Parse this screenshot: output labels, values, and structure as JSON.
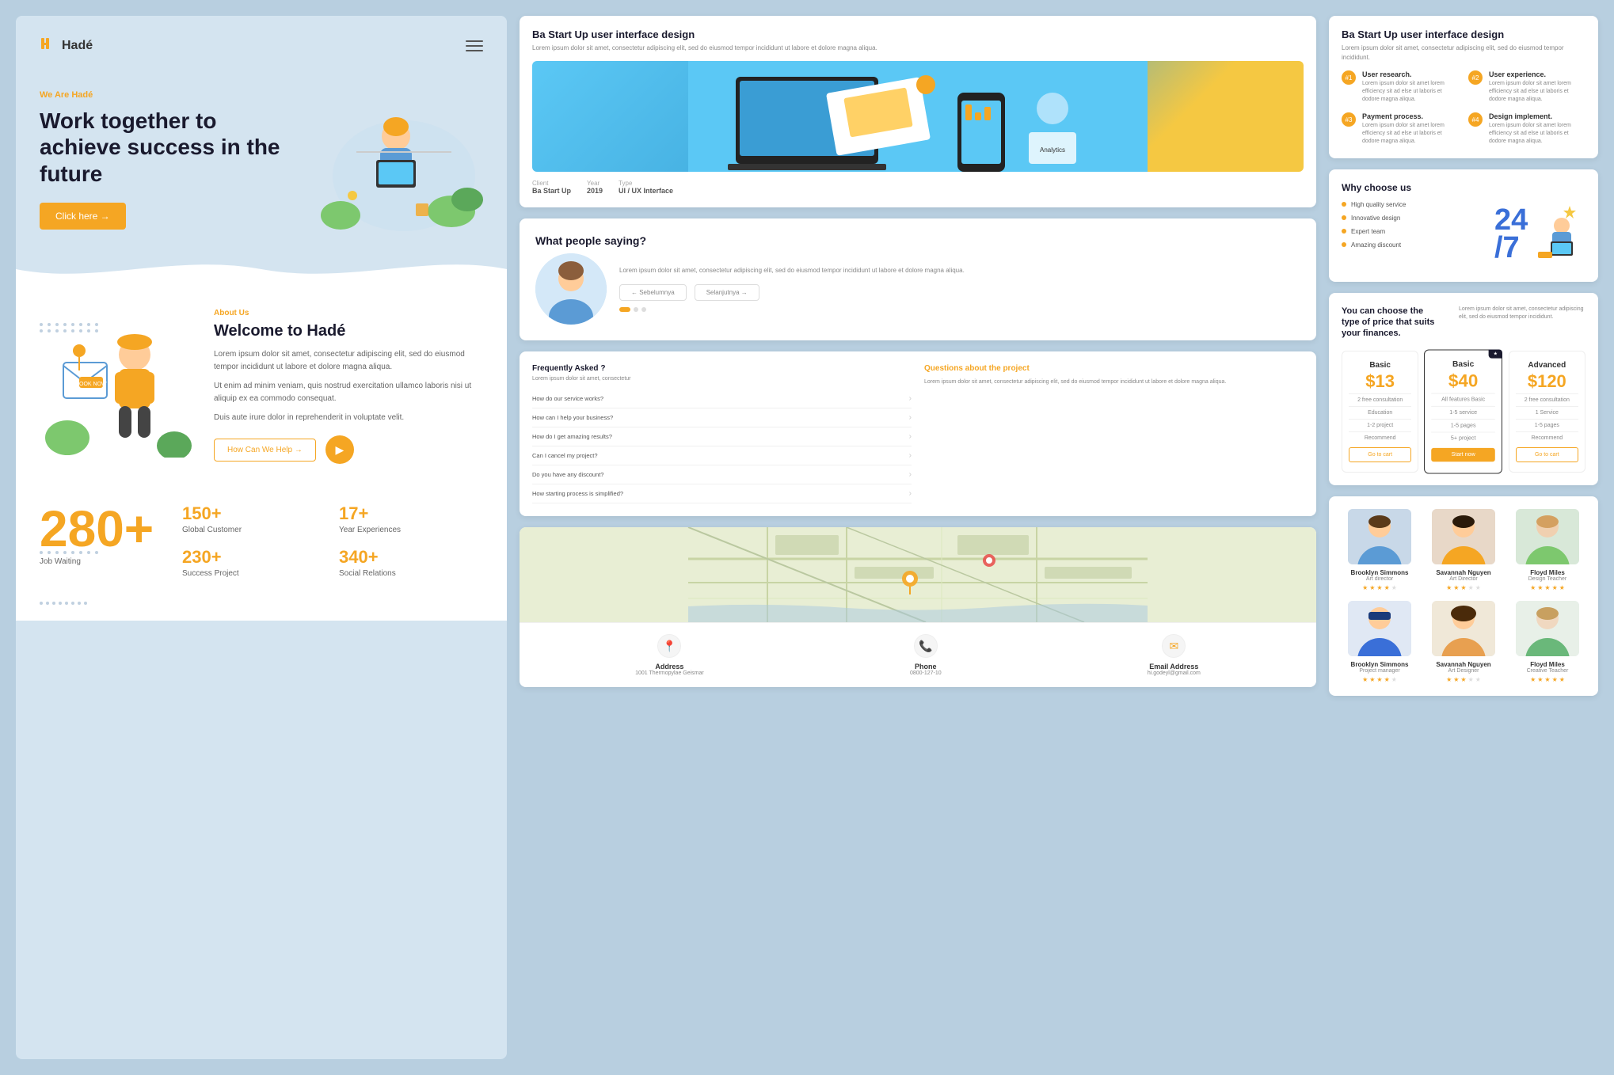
{
  "brand": {
    "name": "Hadé",
    "logo_icon": "H"
  },
  "hero": {
    "subtitle": "We Are Hadé",
    "title": "Work together to achieve success in the future",
    "cta_label": "Click here →"
  },
  "about": {
    "label": "About Us",
    "title": "Welcome to Hadé",
    "body1": "Lorem ipsum dolor sit amet, consectetur adipiscing elit, sed do eiusmod tempor incididunt ut labore et dolore magna aliqua.",
    "body2": "Ut enim ad minim veniam, quis nostrud exercitation ullamco laboris nisi ut aliquip ex ea commodo consequat.",
    "body3": "Duis aute irure dolor in reprehenderit in voluptate velit.",
    "cta_label": "How Can We Help →"
  },
  "stats": {
    "big_number": "280+",
    "big_label": "Job Waiting",
    "items": [
      {
        "number": "150+",
        "label": "Global Customer"
      },
      {
        "number": "17+",
        "label": "Year Experiences"
      },
      {
        "number": "230+",
        "label": "Success Project"
      },
      {
        "number": "340+",
        "label": "Social Relations"
      }
    ]
  },
  "portfolio": {
    "title": "Ba Start Up user interface design",
    "desc": "Lorem ipsum dolor sit amet, consectetur adipiscing elit, sed do eiusmod tempor incididunt ut labore et dolore magna aliqua.",
    "meta": [
      {
        "label": "Client",
        "value": "Ba Start Up"
      },
      {
        "label": "Year",
        "value": "2019"
      },
      {
        "label": "Type",
        "value": "UI / UX Interface"
      }
    ]
  },
  "testimonial": {
    "title": "What people saying?",
    "text": "Lorem ipsum dolor sit amet, consectetur adipiscing elit, sed do eiusmod tempor incididunt ut labore et dolore magna aliqua.",
    "btn1": "← Sebelumnya",
    "btn2": "Selanjutnya →"
  },
  "faq": {
    "heading": "Frequently Asked ?",
    "intro": "Lorem ipsum dolor sit amet, consectetur",
    "questions": [
      "How do our service works?",
      "How can I help your business?",
      "How do I get amazing results?",
      "Can I cancel my project?",
      "Do you have any discount?",
      "How starting process is simplified?"
    ],
    "right_heading": "Questions about the project",
    "right_text": "Lorem ipsum dolor sit amet, consectetur adipiscing elit, sed do eiusmod tempor incididunt ut labore et dolore magna aliqua."
  },
  "contact": {
    "address_label": "Address",
    "address_value": "1001 Thermopylae Geismar",
    "phone_label": "Phone",
    "phone_value": "0800-127-10",
    "email_label": "Email Address",
    "email_value": "hi.godeyl@gmail.com"
  },
  "services_card": {
    "title": "Ba Start Up user interface design",
    "desc": "Lorem ipsum dolor sit amet, consectetur adipiscing elit, sed do eiusmod tempor incididunt.",
    "items": [
      {
        "num": "#1",
        "title": "User research.",
        "desc": "Lorem ipsum dolor sit amet lorem efficiency sit ad else ut laboris et dodore magna aliqua."
      },
      {
        "num": "#2",
        "title": "User experience.",
        "desc": "Lorem ipsum dolor sit amet lorem efficiency sit ad else ut laboris et dodore magna aliqua."
      },
      {
        "num": "#3",
        "title": "Payment process.",
        "desc": "Lorem ipsum dolor sit amet lorem efficiency sit ad else ut laboris et dodore magna aliqua."
      },
      {
        "num": "#4",
        "title": "Design implement.",
        "desc": "Lorem ipsum dolor sit amet lorem efficiency sit ad else ut laboris et dodore magna aliqua."
      }
    ]
  },
  "why_choose": {
    "title": "Why choose us",
    "items": [
      "High quality service",
      "Innovative design",
      "Expert team",
      "Amazing discount"
    ],
    "illustration": "24/7"
  },
  "pricing": {
    "title": "You can choose the type of price that suits your finances.",
    "desc": "Lorem ipsum dolor sit amet, consectetur adipiscing elit, sed do eiusmod tempor incididunt.",
    "plans": [
      {
        "name": "Basic",
        "price": "$13",
        "features": [
          "2 free consultation",
          "Education",
          "1-2 project",
          "Recommend"
        ],
        "btn": "Go to cart",
        "featured": false
      },
      {
        "name": "Basic",
        "price": "$40",
        "badge": "★",
        "features": [
          "All features Basic",
          "1-5 service",
          "1-5 pages",
          "5+ project"
        ],
        "btn": "Start now",
        "featured": true
      },
      {
        "name": "Advanced",
        "price": "$120",
        "features": [
          "2 free consultation",
          "1 Service",
          "1-5 pages",
          "Recommend"
        ],
        "btn": "Go to cart",
        "featured": false
      }
    ]
  },
  "team": {
    "members_row1": [
      {
        "name": "Brooklyn Simmons",
        "role": "Art director",
        "stars": 4
      },
      {
        "name": "Savannah Nguyen",
        "role": "Art Director",
        "stars": 3
      },
      {
        "name": "Floyd Miles",
        "role": "Design Teacher",
        "stars": 5
      }
    ],
    "members_row2": [
      {
        "name": "Brooklyn Simmons",
        "role": "Project manager",
        "stars": 4
      },
      {
        "name": "Savannah Nguyen",
        "role": "Art Designer",
        "stars": 3
      },
      {
        "name": "Floyd Miles",
        "role": "Creative Teacher",
        "stars": 5
      }
    ]
  }
}
